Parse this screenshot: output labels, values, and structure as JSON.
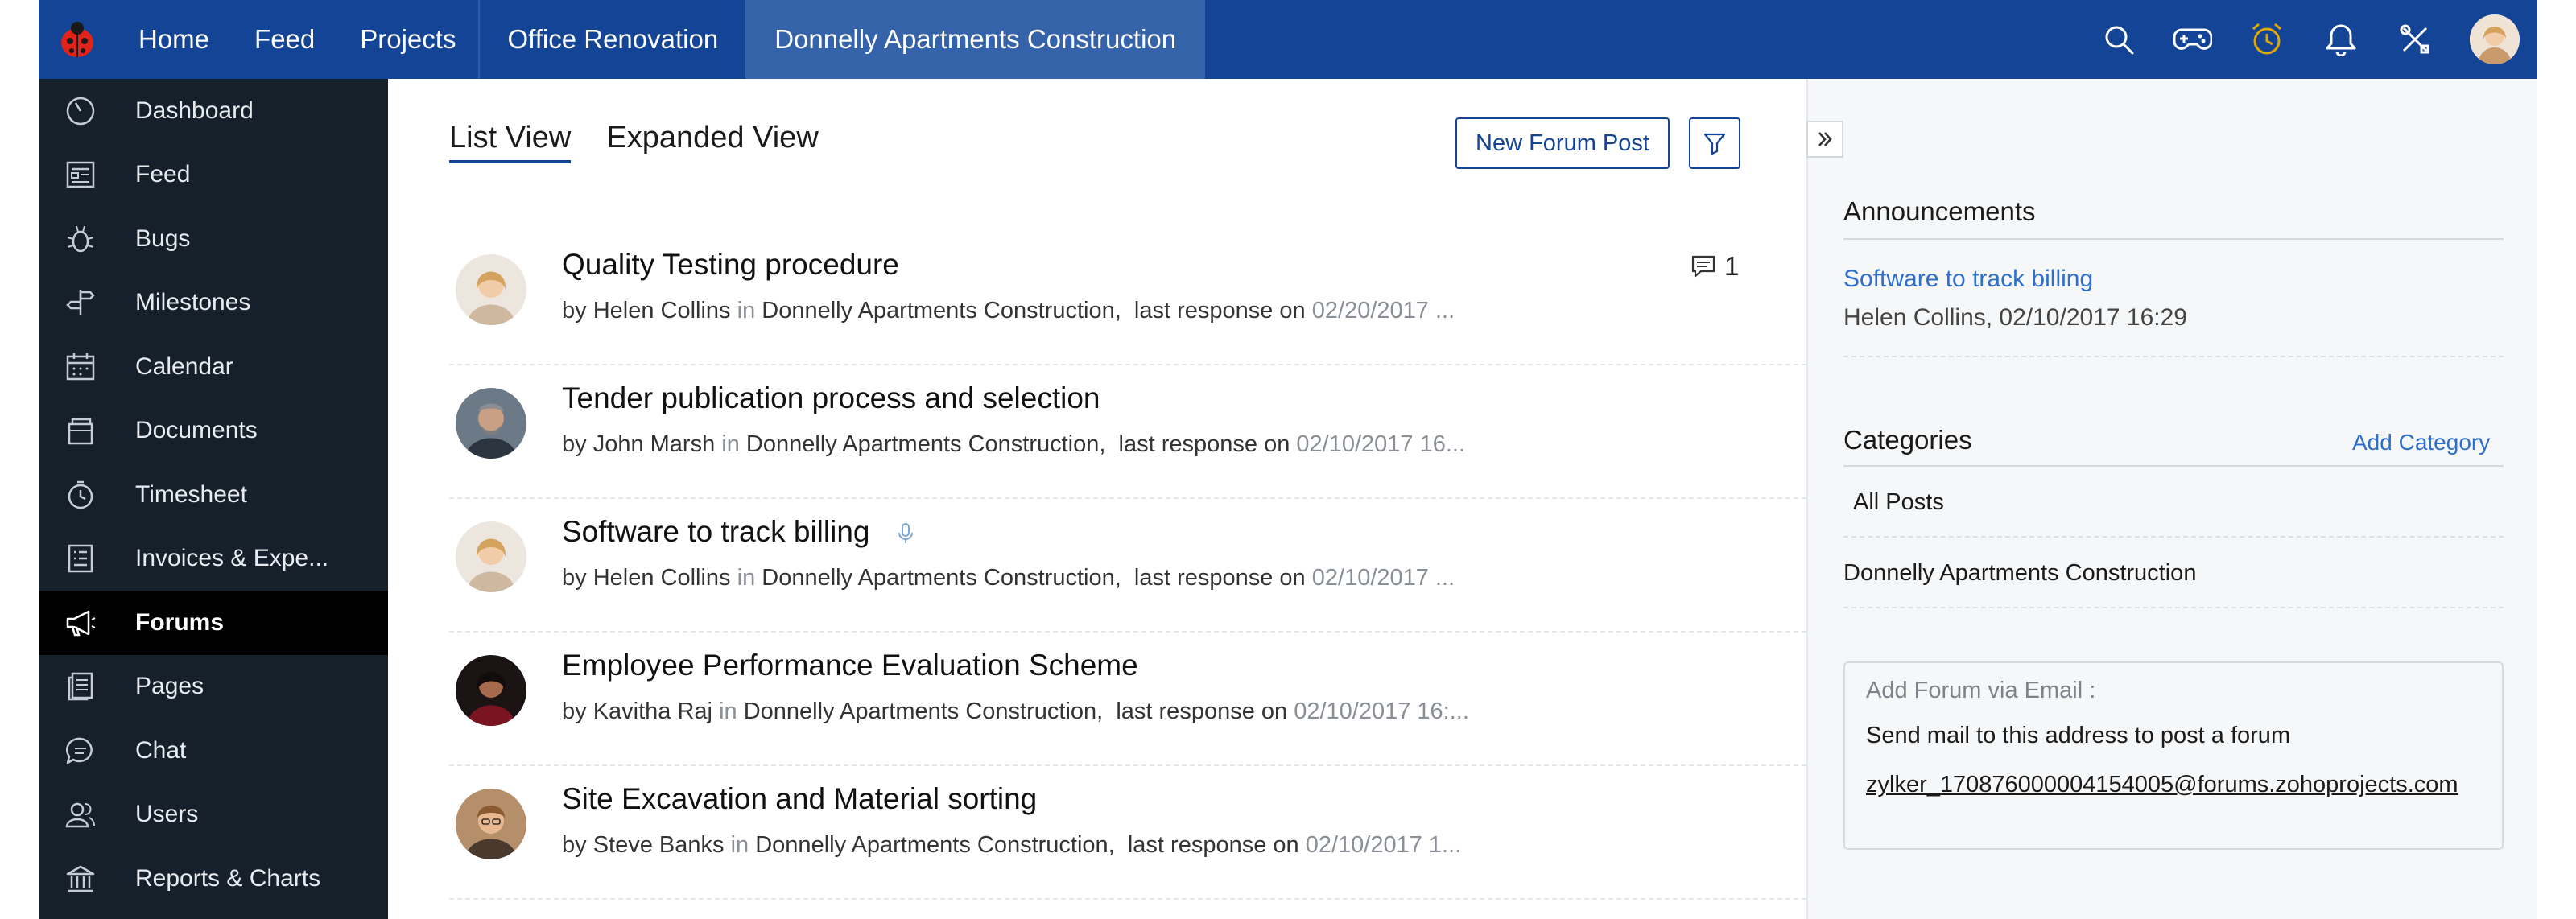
{
  "topbar": {
    "nav": [
      {
        "label": "Home"
      },
      {
        "label": "Feed"
      },
      {
        "label": "Projects"
      }
    ],
    "breadcrumb_1": "Office Renovation",
    "breadcrumb_active": "Donnelly Apartments Construction",
    "icons": [
      "search-icon",
      "gamepad-icon",
      "alarm-clock-icon",
      "bell-icon",
      "tools-icon"
    ],
    "accent_color": "#134496",
    "alarm_color": "#e0a800"
  },
  "sidebar": {
    "items": [
      {
        "label": "Dashboard",
        "icon": "dashboard-icon"
      },
      {
        "label": "Feed",
        "icon": "feed-icon"
      },
      {
        "label": "Bugs",
        "icon": "bug-icon"
      },
      {
        "label": "Milestones",
        "icon": "milestone-icon"
      },
      {
        "label": "Calendar",
        "icon": "calendar-icon"
      },
      {
        "label": "Documents",
        "icon": "documents-icon"
      },
      {
        "label": "Timesheet",
        "icon": "timesheet-icon"
      },
      {
        "label": "Invoices & Expe...",
        "icon": "invoice-icon"
      },
      {
        "label": "Forums",
        "icon": "megaphone-icon",
        "active": true
      },
      {
        "label": "Pages",
        "icon": "pages-icon"
      },
      {
        "label": "Chat",
        "icon": "chat-icon"
      },
      {
        "label": "Users",
        "icon": "users-icon"
      },
      {
        "label": "Reports & Charts",
        "icon": "reports-icon"
      }
    ]
  },
  "main": {
    "tabs": [
      {
        "label": "List View",
        "active": true
      },
      {
        "label": "Expanded View"
      }
    ],
    "new_post_label": "New Forum Post",
    "posts": [
      {
        "title": "Quality Testing procedure",
        "by": "by",
        "author": "Helen Collins",
        "in": "in",
        "project": "Donnelly Apartments Construction,",
        "last_response": "last response on",
        "date": "02/20/2017 ...",
        "comments": "1"
      },
      {
        "title": "Tender publication process and selection",
        "by": "by",
        "author": "John Marsh",
        "in": "in",
        "project": "Donnelly Apartments Construction,",
        "last_response": "last response on",
        "date": "02/10/2017 16..."
      },
      {
        "title": "Software to track billing",
        "by": "by",
        "author": "Helen Collins",
        "in": "in",
        "project": "Donnelly Apartments Construction,",
        "last_response": "last response on",
        "date": "02/10/2017 ..."
      },
      {
        "title": "Employee Performance Evaluation Scheme",
        "by": "by",
        "author": "Kavitha Raj",
        "in": "in",
        "project": "Donnelly Apartments Construction,",
        "last_response": "last response on",
        "date": "02/10/2017 16:..."
      },
      {
        "title": "Site Excavation and Material sorting",
        "by": "by",
        "author": "Steve Banks",
        "in": "in",
        "project": "Donnelly Apartments Construction,",
        "last_response": "last response on",
        "date": "02/10/2017 1..."
      }
    ]
  },
  "rpanel": {
    "announcements_title": "Announcements",
    "announcement_link": "Software to track billing",
    "announcement_meta": "Helen Collins,  02/10/2017 16:29",
    "categories_title": "Categories",
    "add_category": "Add Category",
    "categories": [
      "All Posts",
      "Donnelly Apartments Construction"
    ],
    "email_label": "Add Forum via Email :",
    "email_desc": "Send mail to this address to post a forum",
    "email_address": "zylker_170876000004154005@forums.zohoprojects.com"
  }
}
